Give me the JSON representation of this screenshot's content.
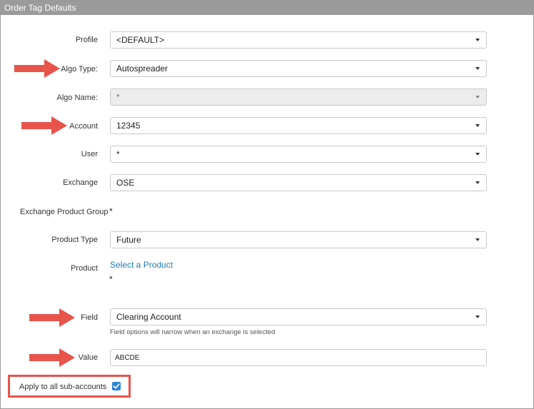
{
  "panel": {
    "title": "Order Tag Defaults"
  },
  "fields": {
    "profile": {
      "label": "Profile",
      "value": "<DEFAULT>"
    },
    "algo_type": {
      "label": "Algo Type:",
      "value": "Autospreader"
    },
    "algo_name": {
      "label": "Algo Name:",
      "value": "*"
    },
    "account": {
      "label": "Account",
      "value": "12345"
    },
    "user": {
      "label": "User",
      "value": "*"
    },
    "exchange": {
      "label": "Exchange",
      "value": "OSE"
    },
    "exchange_product_group": {
      "label": "Exchange Product Group",
      "value": "*"
    },
    "product_type": {
      "label": "Product Type",
      "value": "Future"
    },
    "product": {
      "label": "Product",
      "link": "Select a Product",
      "value": "*"
    },
    "field": {
      "label": "Field",
      "value": "Clearing Account",
      "hint": "Field options will narrow when an exchange is selected"
    },
    "value": {
      "label": "Value",
      "value": "ABCDE"
    }
  },
  "apply_sub_accounts": {
    "label": "Apply to all sub-accounts",
    "checked": true
  },
  "colors": {
    "title_bar": "#9b9b9b",
    "highlight": "#e8534a",
    "link": "#1f7ab8",
    "checkbox": "#2f86d4"
  },
  "icons": {
    "dropdown": "chevron-down-icon",
    "annotation": "red-arrow-icon",
    "check": "check-icon"
  }
}
